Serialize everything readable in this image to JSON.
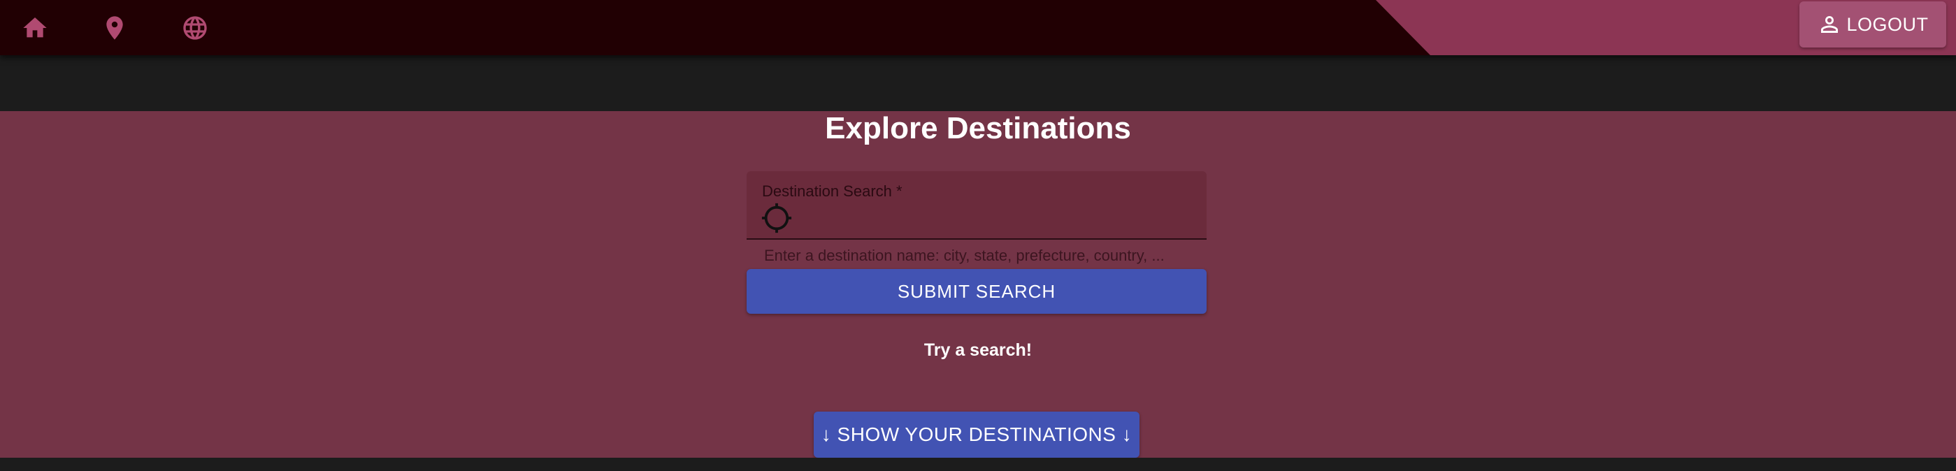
{
  "nav": {
    "icons": [
      "home-icon",
      "location-pin-icon",
      "globe-icon"
    ],
    "logout_label": "LOGOUT",
    "logout_icon": "person-icon"
  },
  "main": {
    "title": "Explore Destinations",
    "search": {
      "label": "Destination Search *",
      "value": "",
      "icon": "crosshair-icon",
      "helper": "Enter a destination name: city, state, prefecture, country, ..."
    },
    "submit_label": "SUBMIT SEARCH",
    "status_text": "Try a search!",
    "show_label": "↓ SHOW YOUR DESTINATIONS ↓"
  },
  "colors": {
    "topbar": "#210003",
    "accent": "#8c3554",
    "main_bg": "#743447",
    "button_blue": "#4253b3"
  }
}
